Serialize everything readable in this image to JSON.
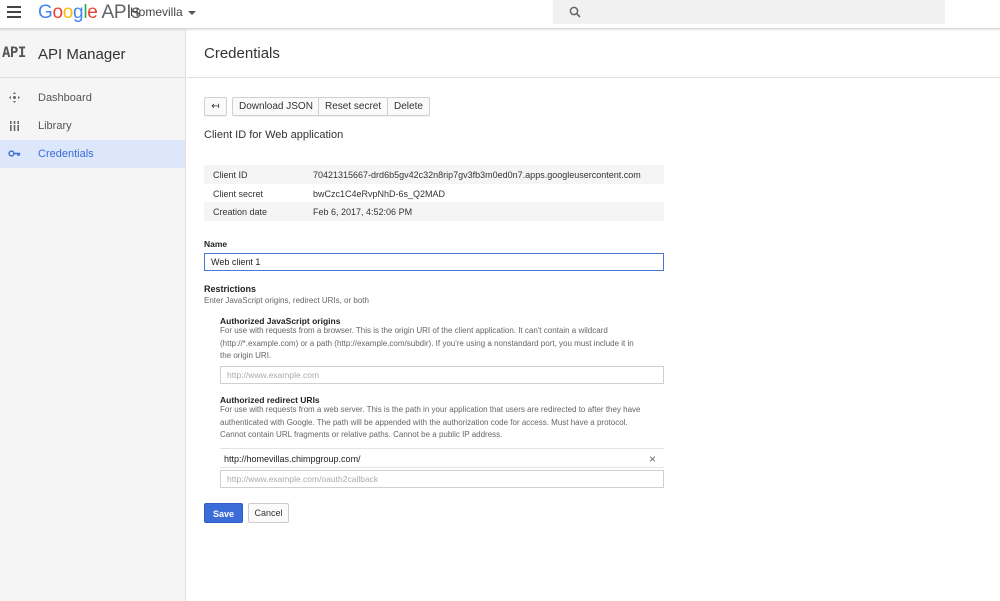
{
  "topbar": {
    "logo_google": [
      "G",
      "o",
      "o",
      "g",
      "l",
      "e"
    ],
    "logo_apis": "APIs",
    "project": "Homevilla"
  },
  "sidebar": {
    "badge": "API",
    "title": "API Manager",
    "items": [
      {
        "label": "Dashboard",
        "icon": "dashboard-icon",
        "active": false
      },
      {
        "label": "Library",
        "icon": "library-icon",
        "active": false
      },
      {
        "label": "Credentials",
        "icon": "key-icon",
        "active": true
      }
    ]
  },
  "main": {
    "title": "Credentials",
    "toolbar": {
      "back": "↤",
      "download": "Download JSON",
      "reset": "Reset secret",
      "delete": "Delete"
    },
    "subtitle": "Client ID for Web application",
    "info": [
      {
        "key": "Client ID",
        "value": "70421315667-drd6b5gv42c32n8rip7gv3fb3m0ed0n7.apps.googleusercontent.com"
      },
      {
        "key": "Client secret",
        "value": "bwCzc1C4eRvpNhD-6s_Q2MAD"
      },
      {
        "key": "Creation date",
        "value": "Feb 6, 2017, 4:52:06 PM"
      }
    ],
    "name_label": "Name",
    "name_value": "Web client 1",
    "restrictions_title": "Restrictions",
    "restrictions_help": "Enter JavaScript origins, redirect URIs, or both",
    "origins_label": "Authorized JavaScript origins",
    "origins_help": [
      "For use with requests from a browser. This is the origin URI of the client application. It can't contain a wildcard",
      "(http://*.example.com) or a path (http://example.com/subdir). If you're using a nonstandard port, you must include it in",
      "the origin URI."
    ],
    "origins_placeholder": "http://www.example.com",
    "redirect_label": "Authorized redirect URIs",
    "redirect_help": [
      "For use with requests from a web server. This is the path in your application that users are redirected to after they have",
      "authenticated with Google. The path will be appended with the authorization code for access. Must have a protocol.",
      "Cannot contain URL fragments or relative paths. Cannot be a public IP address."
    ],
    "redirect_uri": "http://homevillas.chimpgroup.com/",
    "redirect_placeholder": "http://www.example.com/oauth2callback",
    "save": "Save",
    "cancel": "Cancel"
  },
  "colors": {
    "accent": "#3b6cd8",
    "active_bg": "#dce7fb"
  }
}
